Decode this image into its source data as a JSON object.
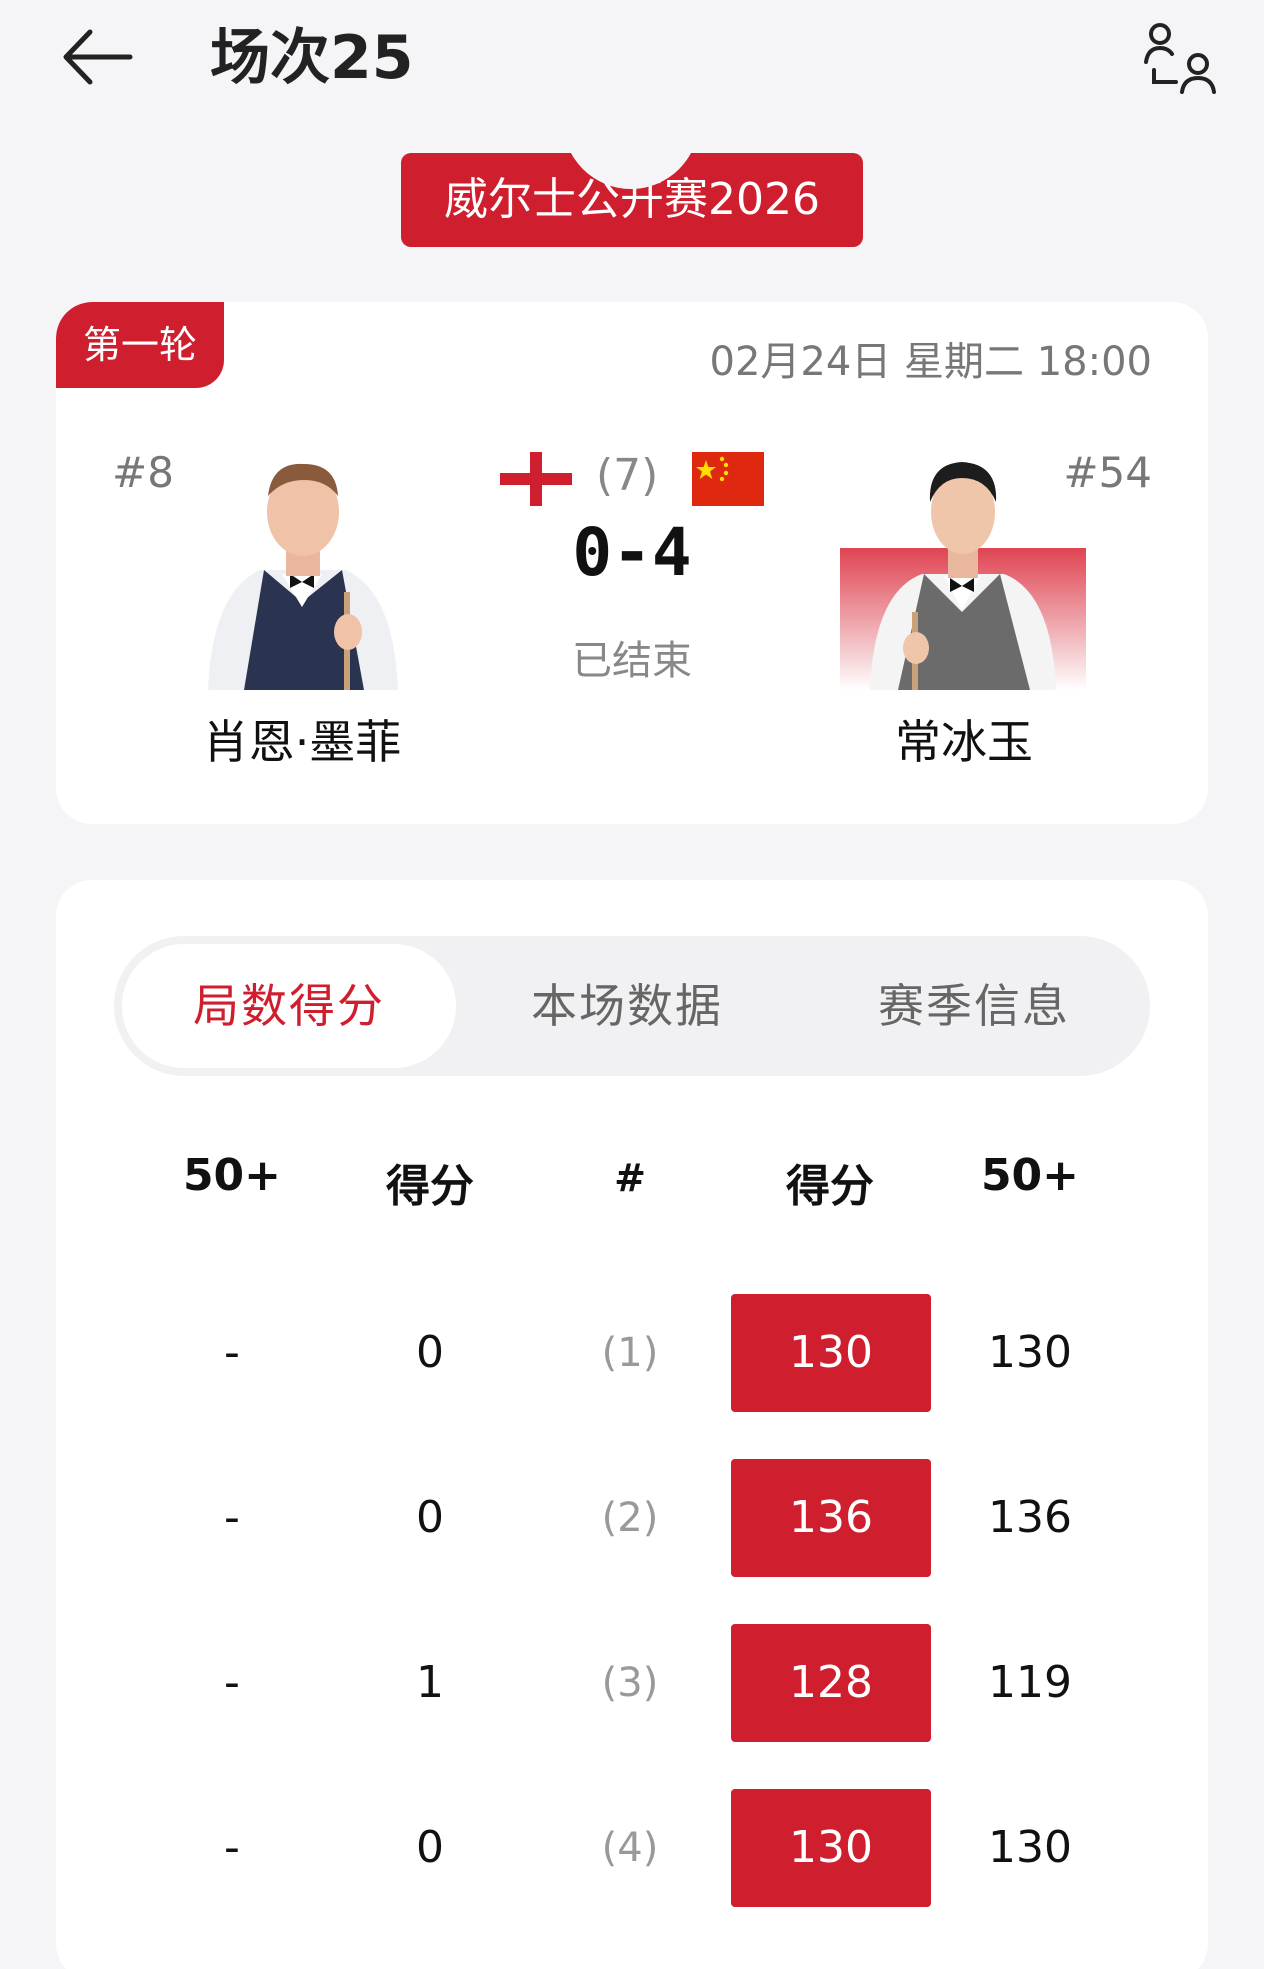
{
  "header": {
    "title": "场次25",
    "back_icon": "arrow-left-icon",
    "users_icon": "users-icon"
  },
  "tournament": {
    "name": "威尔士公开赛2026"
  },
  "match": {
    "round": "第一轮",
    "datetime": "02月24日 星期二 18:00",
    "seed": "(7)",
    "score": "0-4",
    "status": "已结束",
    "player_left": {
      "rank": "#8",
      "name": "肖恩·墨菲",
      "flag": "england-flag"
    },
    "player_right": {
      "rank": "#54",
      "name": "常冰玉",
      "flag": "china-flag"
    }
  },
  "tabs": [
    "局数得分",
    "本场数据",
    "赛季信息"
  ],
  "active_tab": "局数得分",
  "frame_table": {
    "headers": [
      "50+",
      "得分",
      "#",
      "得分",
      "50+"
    ],
    "rows": [
      {
        "left_50": "-",
        "left_score": "0",
        "frame": "(1)",
        "right_score": "130",
        "right_50": "130"
      },
      {
        "left_50": "-",
        "left_score": "0",
        "frame": "(2)",
        "right_score": "136",
        "right_50": "136"
      },
      {
        "left_50": "-",
        "left_score": "1",
        "frame": "(3)",
        "right_score": "128",
        "right_50": "119"
      },
      {
        "left_50": "-",
        "left_score": "0",
        "frame": "(4)",
        "right_score": "130",
        "right_50": "130"
      }
    ]
  },
  "colors": {
    "accent": "#cf1f2e",
    "background": "#f5f5f7"
  }
}
